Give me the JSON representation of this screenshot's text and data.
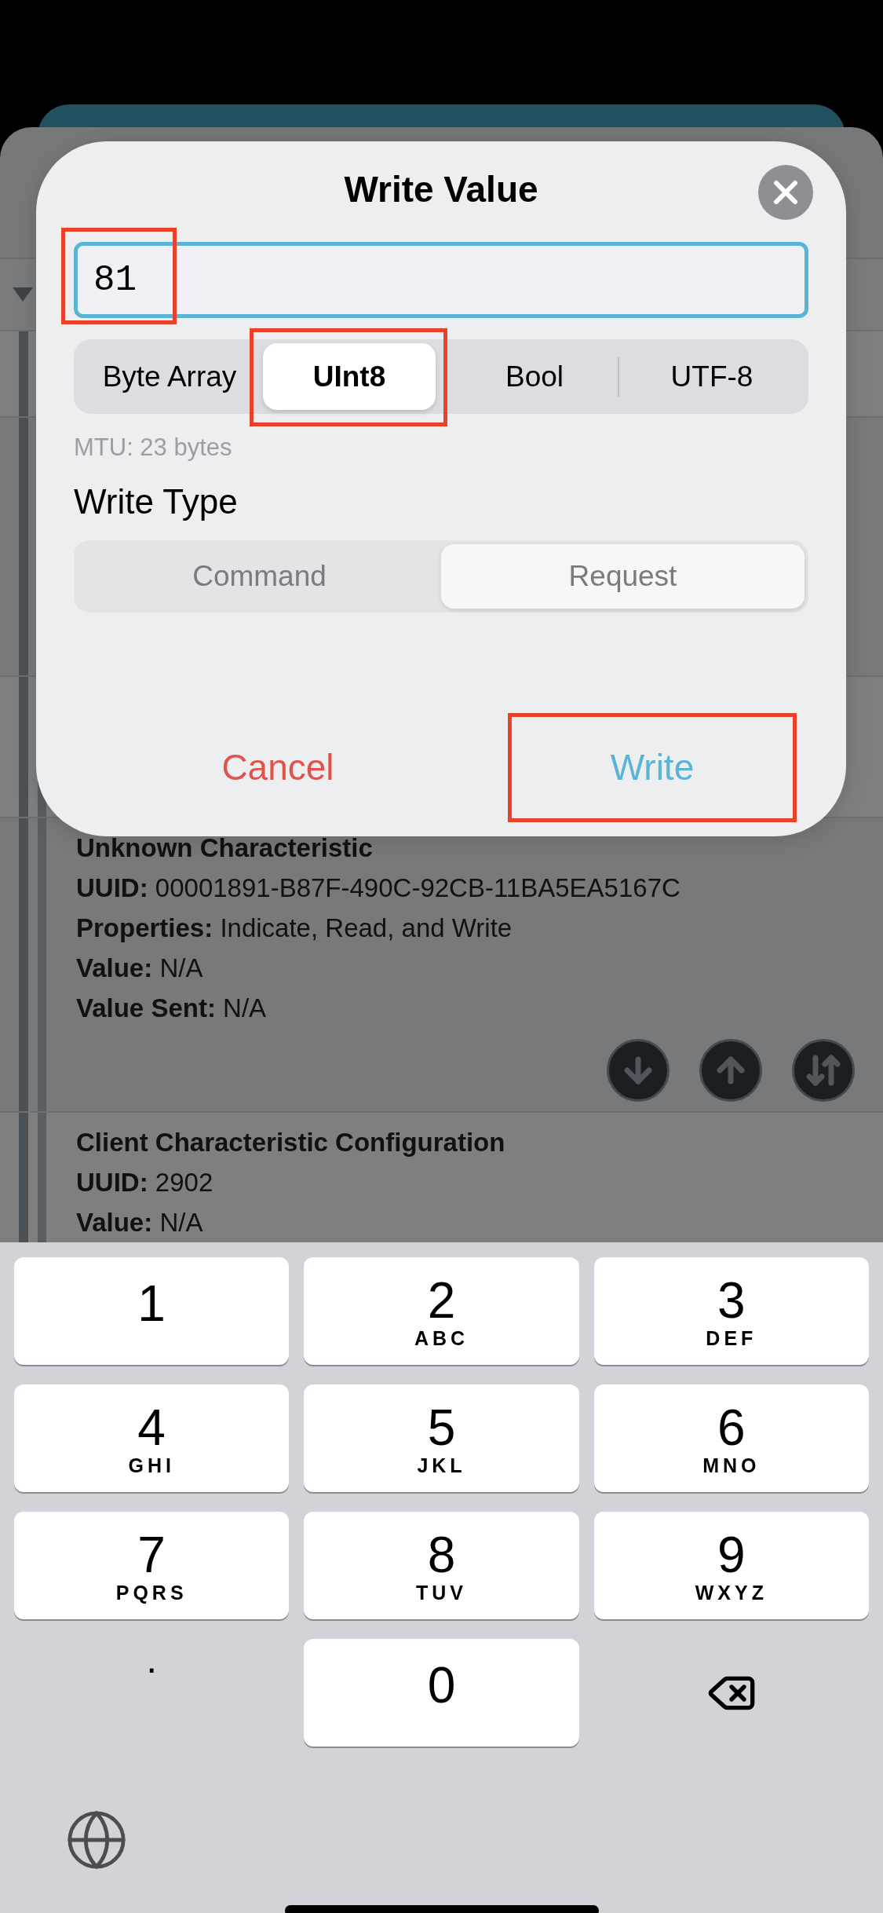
{
  "dialog": {
    "title": "Write Value",
    "value": "81",
    "formats": [
      {
        "label": "Byte Array",
        "selected": false
      },
      {
        "label": "UInt8",
        "selected": true
      },
      {
        "label": "Bool",
        "selected": false
      },
      {
        "label": "UTF-8",
        "selected": false
      }
    ],
    "mtu": "MTU: 23 bytes",
    "write_type_label": "Write Type",
    "write_types": [
      {
        "label": "Command",
        "selected": false
      },
      {
        "label": "Request",
        "selected": true
      }
    ],
    "cancel": "Cancel",
    "write": "Write"
  },
  "characteristics": [
    {
      "name": "Unknown Characteristic",
      "actions": [
        {
          "kind": "read"
        },
        {
          "kind": "write"
        },
        {
          "kind": "notify"
        }
      ],
      "fields": [
        {
          "label": "UUID:",
          "value": "00001891-B87F-490C-92CB-11BA5EA5167C"
        },
        {
          "label": "Properties:",
          "value": "Indicate, Read, and Write"
        },
        {
          "label": "Value:",
          "value": "N/A"
        },
        {
          "label": "Value Sent:",
          "value": "N/A"
        }
      ]
    },
    {
      "name": "Client Characteristic Configuration",
      "fields": [
        {
          "label": "UUID:",
          "value": "2902"
        },
        {
          "label": "Value:",
          "value": "N/A"
        }
      ]
    }
  ],
  "keyboard": [
    {
      "kind": "digit",
      "digit": "1"
    },
    {
      "kind": "digit",
      "digit": "2",
      "letters": "ABC"
    },
    {
      "kind": "digit",
      "digit": "3",
      "letters": "DEF"
    },
    {
      "kind": "digit",
      "digit": "4",
      "letters": "GHI"
    },
    {
      "kind": "digit",
      "digit": "5",
      "letters": "JKL"
    },
    {
      "kind": "digit",
      "digit": "6",
      "letters": "MNO"
    },
    {
      "kind": "digit",
      "digit": "7",
      "letters": "PQRS"
    },
    {
      "kind": "digit",
      "digit": "8",
      "letters": "TUV"
    },
    {
      "kind": "digit",
      "digit": "9",
      "letters": "WXYZ"
    },
    {
      "kind": "symbol",
      "digit": "."
    },
    {
      "kind": "digit",
      "digit": "0"
    },
    {
      "kind": "delete"
    }
  ]
}
